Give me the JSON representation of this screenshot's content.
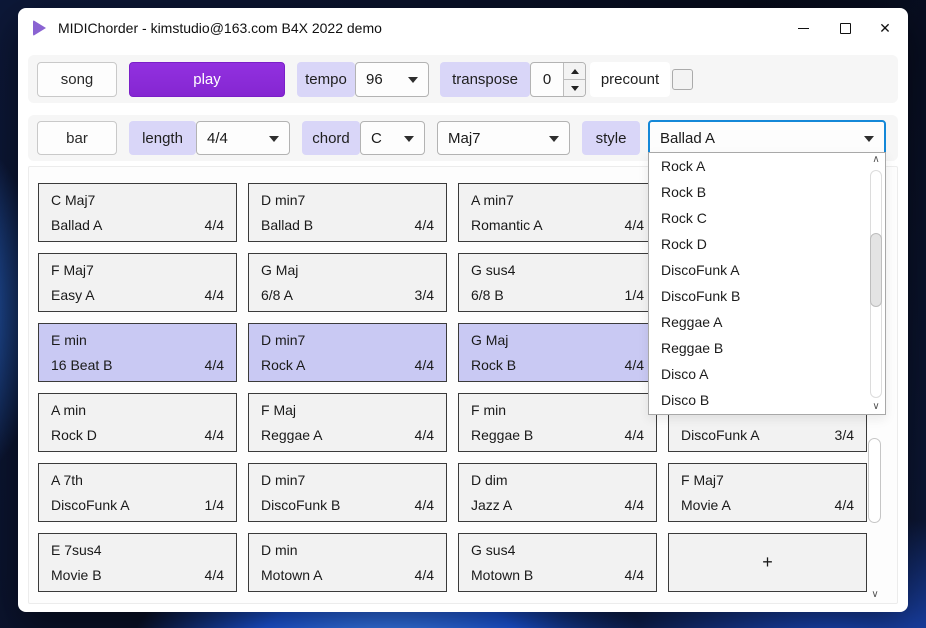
{
  "window": {
    "title": "MIDIChorder - kimstudio@163.com B4X 2022 demo"
  },
  "toolbar": {
    "song_label": "song",
    "play_label": "play",
    "tempo_label": "tempo",
    "tempo_value": "96",
    "transpose_label": "transpose",
    "transpose_value": "0",
    "precount_label": "precount",
    "precount_checked": false
  },
  "bar_toolbar": {
    "bar_label": "bar",
    "length_label": "length",
    "length_value": "4/4",
    "chord_label": "chord",
    "chord_root_value": "C",
    "chord_type_value": "Maj7",
    "style_label": "style",
    "style_value": "Ballad A"
  },
  "style_dropdown": {
    "options": [
      "Rock A",
      "Rock B",
      "Rock C",
      "Rock D",
      "DiscoFunk A",
      "DiscoFunk B",
      "Reggae A",
      "Reggae B",
      "Disco A",
      "Disco B"
    ]
  },
  "grid": {
    "add_label": "+",
    "cards": [
      {
        "chord": "C Maj7",
        "style": "Ballad A",
        "sig": "4/4",
        "highlighted": false
      },
      {
        "chord": "D min7",
        "style": "Ballad B",
        "sig": "4/4",
        "highlighted": false
      },
      {
        "chord": "A min7",
        "style": "Romantic A",
        "sig": "4/4",
        "highlighted": false
      },
      {
        "chord": "",
        "style": "",
        "sig": "",
        "highlighted": false
      },
      {
        "chord": "F Maj7",
        "style": "Easy A",
        "sig": "4/4",
        "highlighted": false
      },
      {
        "chord": "G Maj",
        "style": "6/8 A",
        "sig": "3/4",
        "highlighted": false
      },
      {
        "chord": "G sus4",
        "style": "6/8 B",
        "sig": "1/4",
        "highlighted": false
      },
      {
        "chord": "",
        "style": "",
        "sig": "",
        "highlighted": false
      },
      {
        "chord": "E min",
        "style": "16 Beat B",
        "sig": "4/4",
        "highlighted": true
      },
      {
        "chord": "D min7",
        "style": "Rock A",
        "sig": "4/4",
        "highlighted": true
      },
      {
        "chord": "G Maj",
        "style": "Rock B",
        "sig": "4/4",
        "highlighted": true
      },
      {
        "chord": "",
        "style": "",
        "sig": "",
        "highlighted": true
      },
      {
        "chord": "A min",
        "style": "Rock D",
        "sig": "4/4",
        "highlighted": false
      },
      {
        "chord": "F Maj",
        "style": "Reggae A",
        "sig": "4/4",
        "highlighted": false
      },
      {
        "chord": "F min",
        "style": "Reggae B",
        "sig": "4/4",
        "highlighted": false
      },
      {
        "chord": "",
        "style": "DiscoFunk A",
        "sig": "3/4",
        "highlighted": false
      },
      {
        "chord": "A 7th",
        "style": "DiscoFunk A",
        "sig": "1/4",
        "highlighted": false
      },
      {
        "chord": "D min7",
        "style": "DiscoFunk B",
        "sig": "4/4",
        "highlighted": false
      },
      {
        "chord": "D dim",
        "style": "Jazz A",
        "sig": "4/4",
        "highlighted": false
      },
      {
        "chord": "F Maj7",
        "style": "Movie A",
        "sig": "4/4",
        "highlighted": false
      },
      {
        "chord": "E 7sus4",
        "style": "Movie B",
        "sig": "4/4",
        "highlighted": false
      },
      {
        "chord": "D min",
        "style": "Motown A",
        "sig": "4/4",
        "highlighted": false
      },
      {
        "chord": "G sus4",
        "style": "Motown B",
        "sig": "4/4",
        "highlighted": false
      }
    ]
  },
  "colors": {
    "accent_purple": "#8526d2",
    "label_lavender": "#d9d6f8",
    "card_highlight": "#c9c9f3",
    "focus_blue": "#1488d8"
  }
}
